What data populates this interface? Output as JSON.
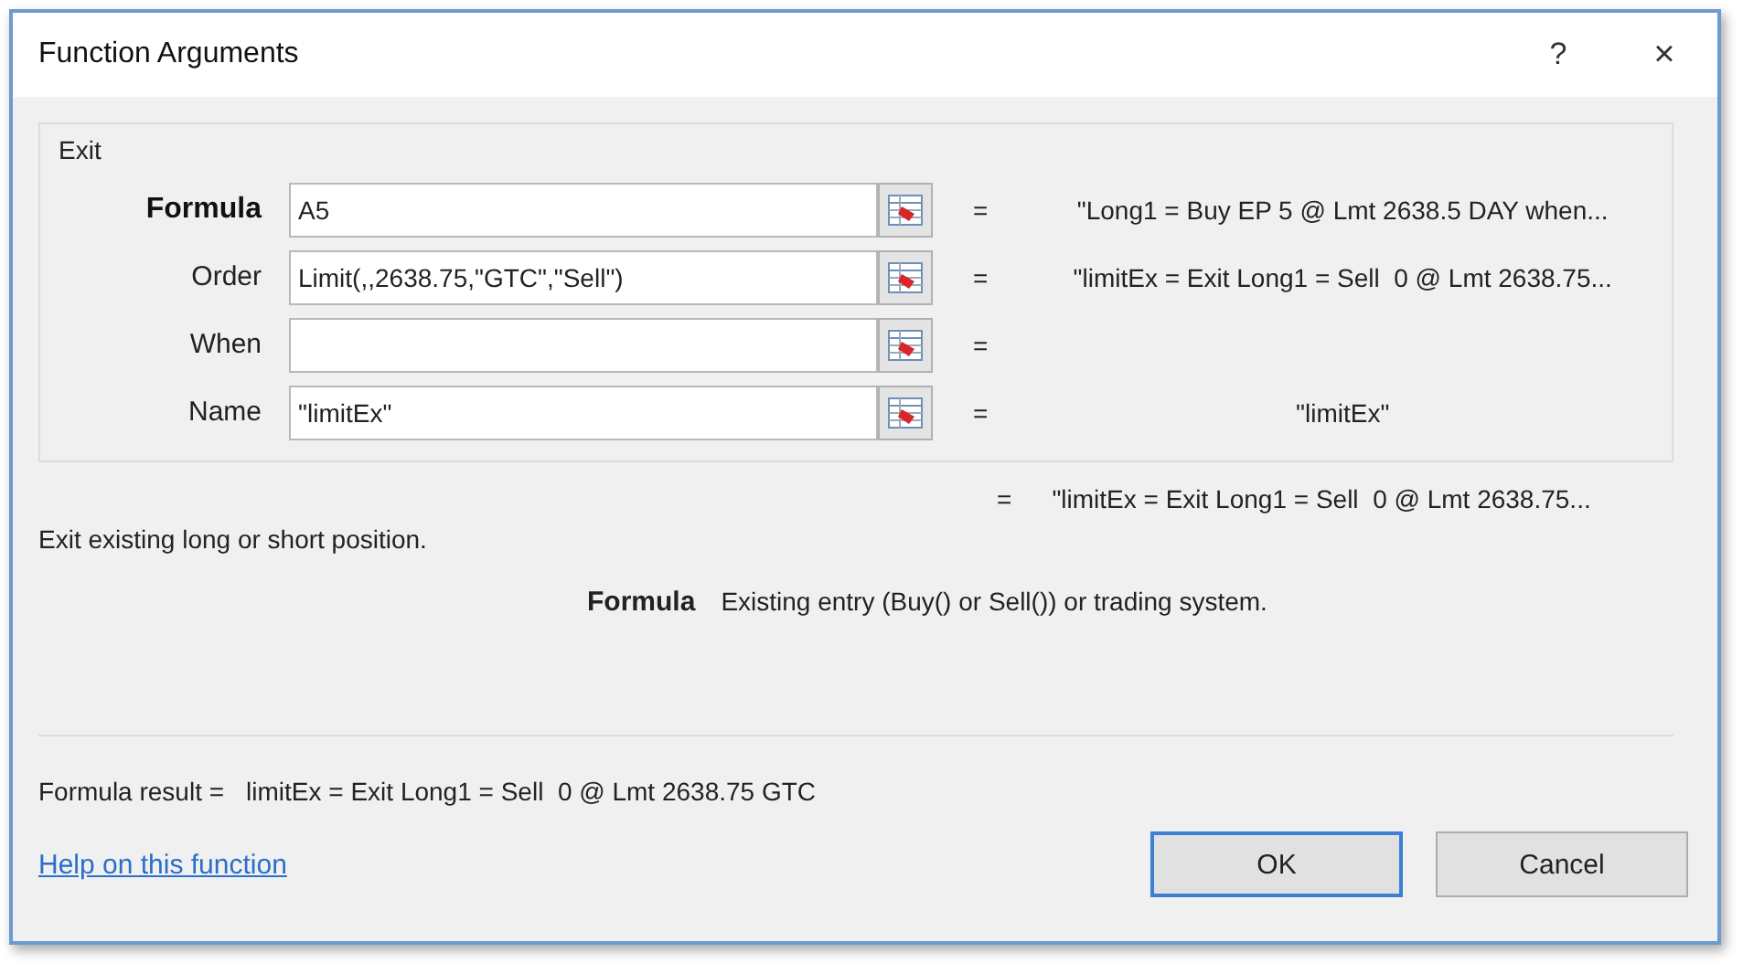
{
  "window": {
    "title": "Function Arguments",
    "help_button": "?",
    "close_button": "×"
  },
  "group": {
    "title": "Exit",
    "arguments": [
      {
        "label": "Formula",
        "value": "A5",
        "selected": true,
        "result": "\"Long1 = Buy EP 5 @ Lmt 2638.5 DAY when...",
        "equals": "="
      },
      {
        "label": "Order",
        "value": "Limit(,,2638.75,\"GTC\",\"Sell\")",
        "selected": false,
        "result": "\"limitEx = Exit Long1 = Sell  0 @ Lmt 2638.75...",
        "equals": "="
      },
      {
        "label": "When",
        "selected": false,
        "equals": "="
      },
      {
        "label": "Name",
        "value": "\"limitEx\"",
        "selected": false,
        "result": "\"limitEx\"",
        "equals": "="
      }
    ]
  },
  "function_result": {
    "equals": "=",
    "value": "\"limitEx = Exit Long1 = Sell  0 @ Lmt 2638.75..."
  },
  "description": "Exit existing long or short position.",
  "argument_help": {
    "name": "Formula",
    "text": "Existing entry (Buy() or Sell()) or trading system."
  },
  "formula_result": {
    "label": "Formula result =",
    "value": "limitEx = Exit Long1 = Sell  0 @ Lmt 2638.75 GTC"
  },
  "help_link": "Help on this function",
  "buttons": [
    {
      "label": "OK",
      "default": true
    },
    {
      "label": "Cancel",
      "default": false
    }
  ]
}
